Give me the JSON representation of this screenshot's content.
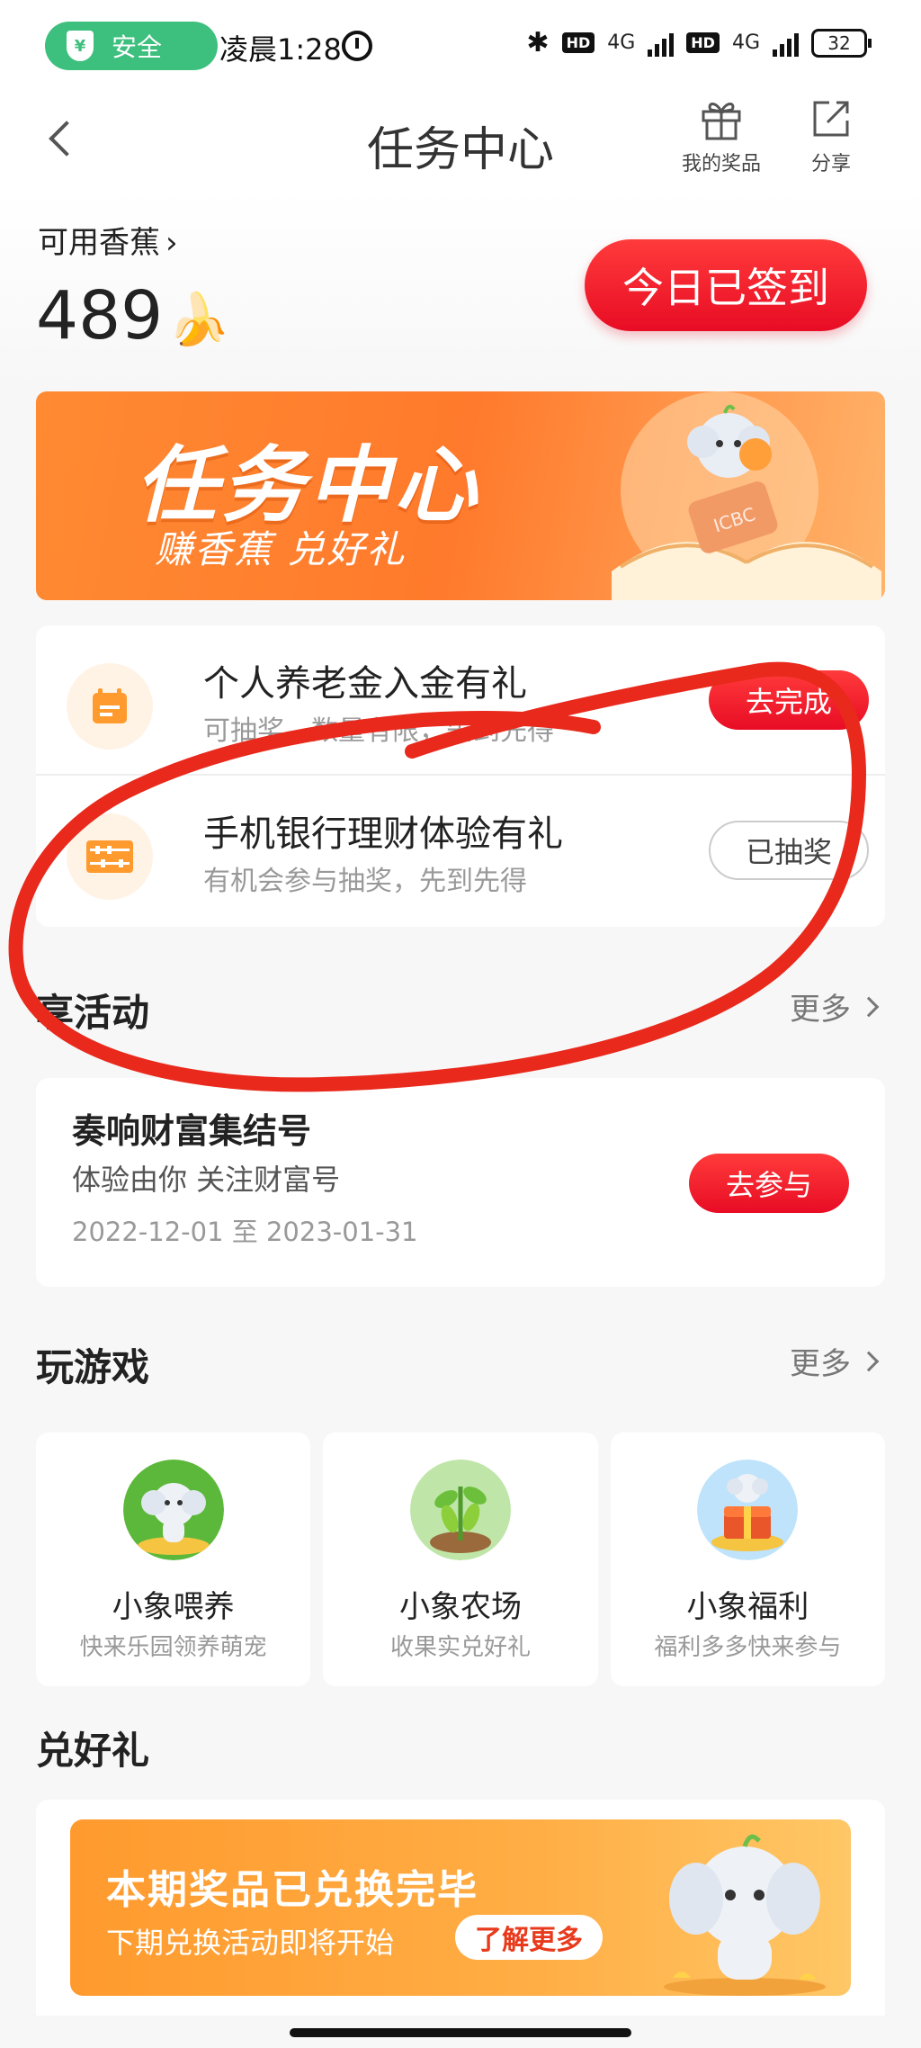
{
  "status_bar": {
    "safe_label": "安全",
    "shield_symbol": "¥",
    "time": "凌晨1:28",
    "hd1": "HD",
    "net1": "4G",
    "hd2": "HD",
    "net2": "4G",
    "battery": "32"
  },
  "header": {
    "title": "任务中心",
    "gift_label": "我的奖品",
    "share_label": "分享"
  },
  "balance": {
    "label": "可用香蕉",
    "value": "489",
    "signed_button": "今日已签到"
  },
  "hero": {
    "title": "任务中心",
    "subtitle": "赚香蕉 兑好礼",
    "brand": "ICBC"
  },
  "tasks": [
    {
      "title": "个人养老金入金有礼",
      "desc": "可抽奖，数量有限，先到先得",
      "button": "去完成",
      "icon": "calendar-icon"
    },
    {
      "title": "手机银行理财体验有礼",
      "desc": "有机会参与抽奖，先到先得",
      "button": "已抽奖",
      "icon": "abacus-icon"
    }
  ],
  "activities": {
    "section_title": "享活动",
    "more": "更多",
    "item": {
      "title": "奏响财富集结号",
      "subtitle": "体验由你 关注财富号",
      "date": "2022-12-01 至 2023-01-31",
      "button": "去参与"
    }
  },
  "games": {
    "section_title": "玩游戏",
    "more": "更多",
    "items": [
      {
        "name": "小象喂养",
        "desc": "快来乐园领养萌宠",
        "icon": "elephant-feeding-icon"
      },
      {
        "name": "小象农场",
        "desc": "收果实兑好礼",
        "icon": "bean-farm-icon"
      },
      {
        "name": "小象福利",
        "desc": "福利多多快来参与",
        "icon": "gift-chest-icon"
      }
    ]
  },
  "rewards": {
    "section_title": "兑好礼",
    "banner_title": "本期奖品已兑换完毕",
    "banner_subtitle": "下期兑换活动即将开始",
    "banner_button": "了解更多"
  },
  "colors": {
    "accent_red": "#e80c24",
    "safe_green": "#3dbf7e",
    "hero_orange": "#ff7a2c",
    "annotation_red": "#e8291c"
  }
}
